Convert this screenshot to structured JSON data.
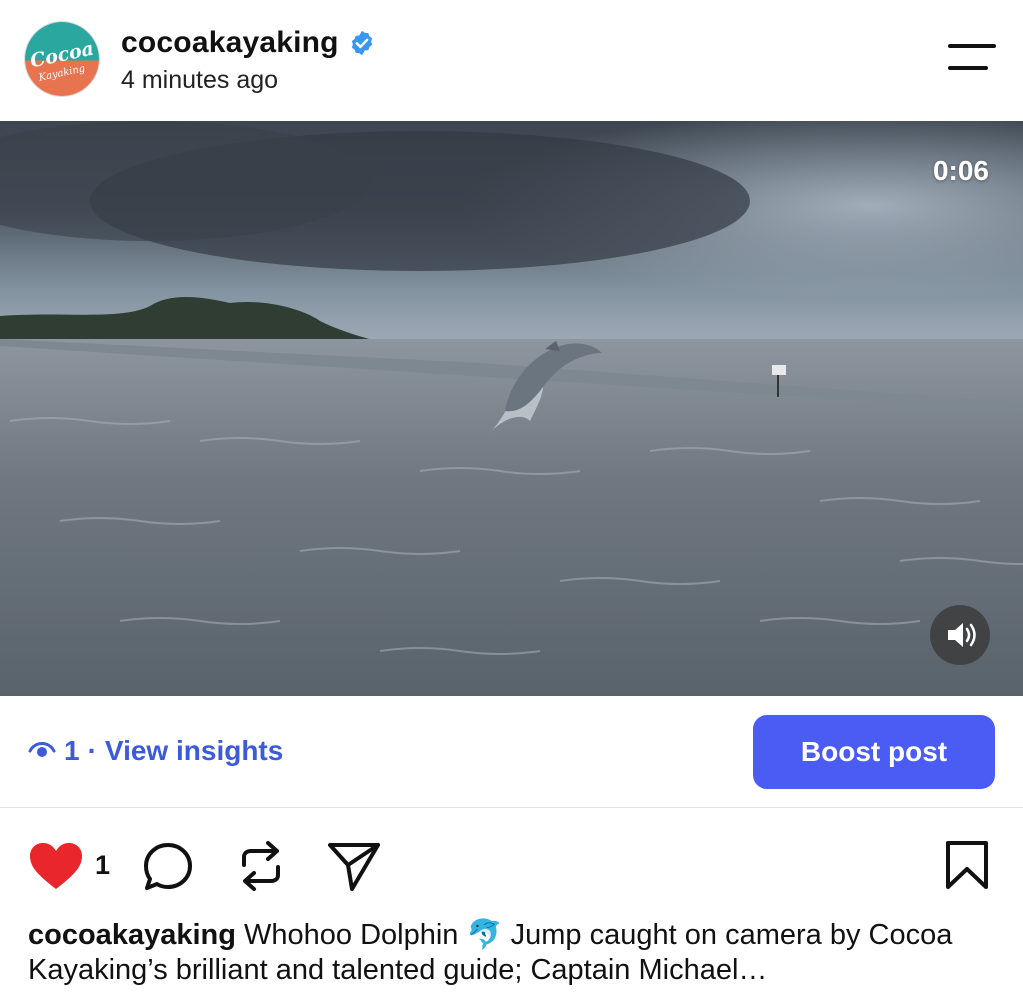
{
  "header": {
    "username": "cocoakayaking",
    "timestamp": "4 minutes ago",
    "avatar_text": "Cocoa",
    "avatar_subtext": "Kayaking",
    "verified_icon": "verified-badge-icon",
    "menu_icon": "menu-icon"
  },
  "media": {
    "duration": "0:06",
    "sound_icon": "speaker-icon"
  },
  "insights": {
    "icon": "eye-icon",
    "count": "1",
    "separator": "·",
    "label": "View insights",
    "color": "#3b5bdb"
  },
  "boost": {
    "label": "Boost post",
    "color": "#4b5cf4"
  },
  "actions": {
    "like_icon": "heart-icon",
    "like_count": "1",
    "comment_icon": "comment-icon",
    "repost_icon": "repost-icon",
    "share_icon": "send-icon",
    "save_icon": "bookmark-icon",
    "like_color": "#e8262b"
  },
  "caption": {
    "username": "cocoakayaking",
    "text_part1": " Whohoo Dolphin ",
    "emoji": "🐬",
    "text_part2": " Jump caught on camera by Cocoa Kayaking’s brilliant and talented guide; Captain Michael…"
  }
}
